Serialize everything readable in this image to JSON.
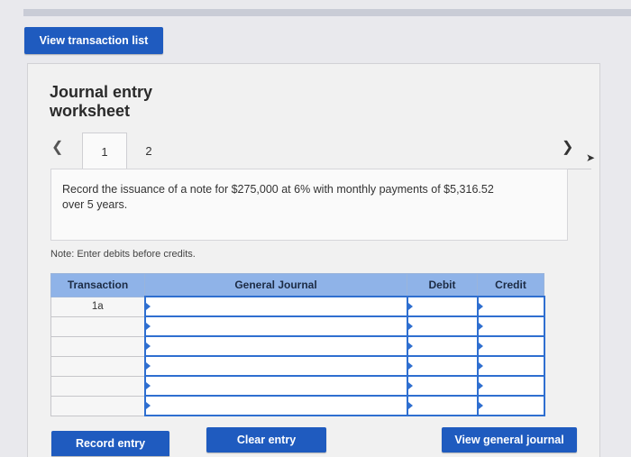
{
  "header": {
    "view_transaction_list_label": "View transaction list"
  },
  "worksheet": {
    "title_line1": "Journal entry",
    "title_line2": "worksheet",
    "tabs": [
      {
        "label": "1"
      },
      {
        "label": "2"
      }
    ],
    "prev_icon": "chevron-left-icon",
    "next_icon": "chevron-right-icon",
    "question": "Record the issuance of a note for $275,000 at 6% with monthly payments of $5,316.52 over 5 years.",
    "note": "Note: Enter debits before credits."
  },
  "table": {
    "headers": {
      "transaction": "Transaction",
      "general_journal": "General Journal",
      "debit": "Debit",
      "credit": "Credit"
    },
    "rows": [
      {
        "transaction": "1a",
        "account": "",
        "debit": "",
        "credit": ""
      },
      {
        "transaction": "",
        "account": "",
        "debit": "",
        "credit": ""
      },
      {
        "transaction": "",
        "account": "",
        "debit": "",
        "credit": ""
      },
      {
        "transaction": "",
        "account": "",
        "debit": "",
        "credit": ""
      },
      {
        "transaction": "",
        "account": "",
        "debit": "",
        "credit": ""
      },
      {
        "transaction": "",
        "account": "",
        "debit": "",
        "credit": ""
      }
    ]
  },
  "actions": {
    "record_entry_label": "Record entry",
    "clear_entry_label": "Clear entry",
    "view_general_journal_label": "View general journal"
  },
  "colors": {
    "accent": "#1f5bbf",
    "table_header": "#8fb3e8",
    "input_border": "#2f6fd0"
  }
}
